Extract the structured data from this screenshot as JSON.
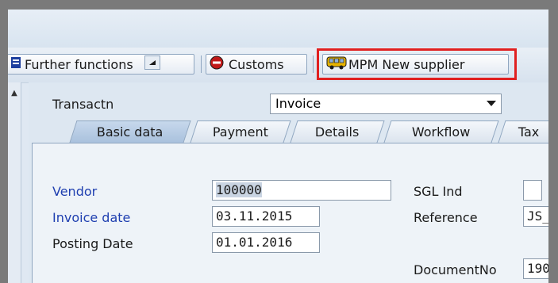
{
  "toolbar": {
    "further_functions": "Further functions",
    "customs": "Customs",
    "mpm_new_supplier": "MPM New supplier"
  },
  "header": {
    "transactn_label": "Transactn",
    "transactn_value": "Invoice"
  },
  "tabs": [
    "Basic data",
    "Payment",
    "Details",
    "Workflow",
    "Tax"
  ],
  "form": {
    "vendor_label": "Vendor",
    "vendor_value": "100000",
    "invoice_date_label": "Invoice date",
    "invoice_date_value": "03.11.2015",
    "posting_date_label": "Posting Date",
    "posting_date_value": "01.01.2016",
    "sgl_ind_label": "SGL Ind",
    "sgl_ind_value": "",
    "reference_label": "Reference",
    "reference_value": "JS_",
    "documentno_label": "DocumentNo",
    "documentno_value": "190"
  },
  "colors": {
    "highlight_box": "#e02020",
    "field_label_blue": "#1f3fb0",
    "frame": "#7a7a7a"
  }
}
